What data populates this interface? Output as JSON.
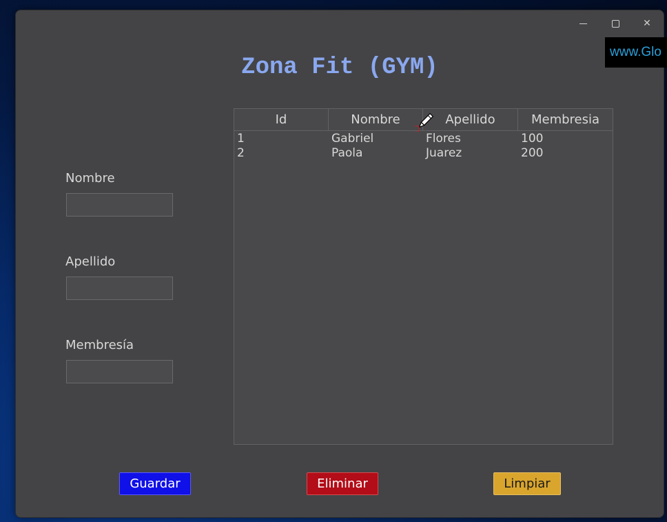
{
  "window": {
    "controls": {
      "minimize": "minimize-icon",
      "maximize": "maximize-icon",
      "close": "close-icon"
    }
  },
  "watermark": "www.Glo",
  "app_title": "Zona Fit (GYM)",
  "form": {
    "nombre_label": "Nombre",
    "nombre_value": "",
    "apellido_label": "Apellido",
    "apellido_value": "",
    "membresia_label": "Membresía",
    "membresia_value": ""
  },
  "table": {
    "columns": [
      "Id",
      "Nombre",
      "Apellido",
      "Membresia"
    ],
    "rows": [
      [
        "1",
        "Gabriel",
        "Flores",
        "100"
      ],
      [
        "2",
        "Paola",
        "Juarez",
        "200"
      ]
    ]
  },
  "buttons": {
    "save": "Guardar",
    "delete": "Eliminar",
    "clear": "Limpiar"
  },
  "colors": {
    "title": "#8aa8f0",
    "save": "#1010e8",
    "delete": "#b20d18",
    "clear": "#d9a52d"
  }
}
